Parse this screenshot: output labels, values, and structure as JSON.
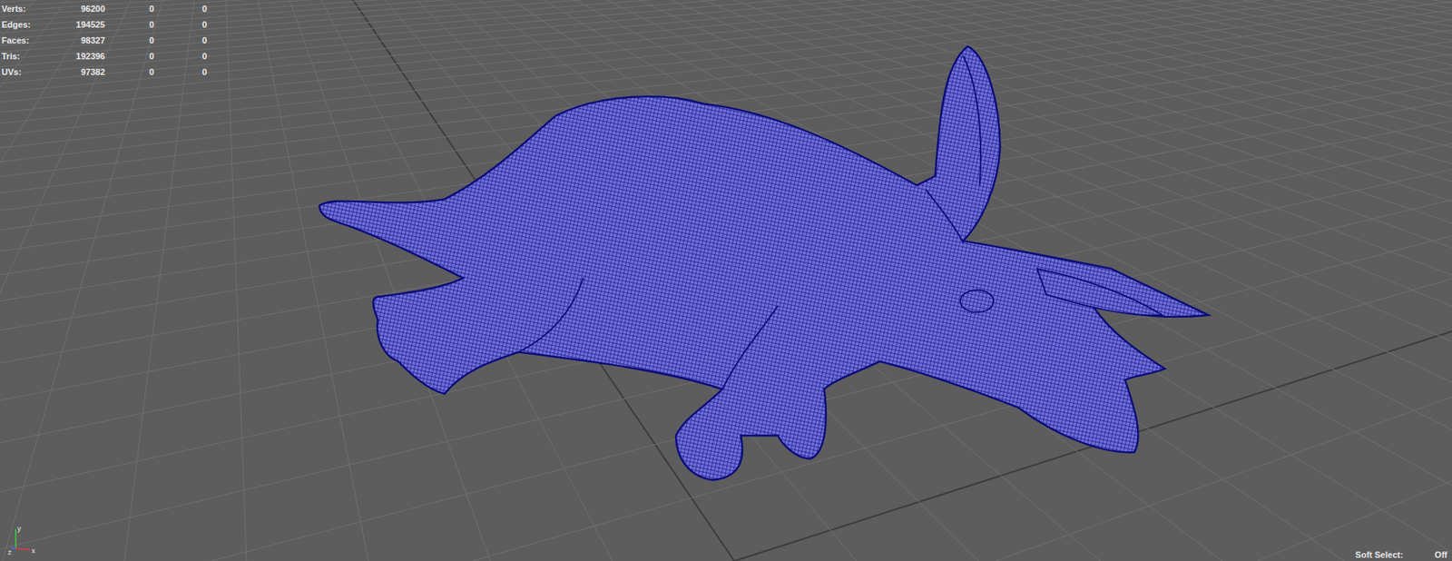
{
  "hud": [
    {
      "label": "Verts:",
      "values": [
        "96200",
        "0",
        "0"
      ]
    },
    {
      "label": "Edges:",
      "values": [
        "194525",
        "0",
        "0"
      ]
    },
    {
      "label": "Faces:",
      "values": [
        "98327",
        "0",
        "0"
      ]
    },
    {
      "label": "Tris:",
      "values": [
        "192396",
        "0",
        "0"
      ]
    },
    {
      "label": "UVs:",
      "values": [
        "97382",
        "0",
        "0"
      ]
    }
  ],
  "axes": [
    {
      "label": "y",
      "color": "#3fcf3f"
    },
    {
      "label": "z",
      "color": "#4a6cff"
    },
    {
      "label": "x",
      "color": "#e04040"
    }
  ],
  "soft_select": {
    "label": "Soft Select:",
    "value": "Off"
  }
}
